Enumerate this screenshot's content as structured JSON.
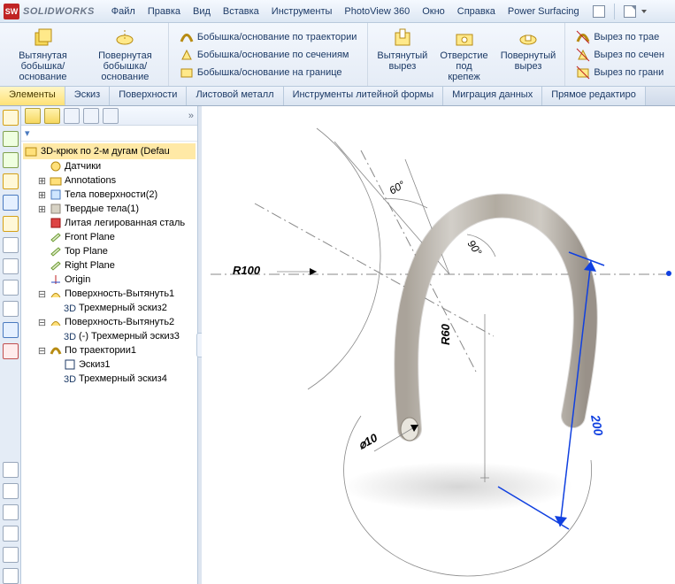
{
  "app": {
    "brand": "SOLIDWORKS",
    "logo_text": "SW"
  },
  "menu": [
    "Файл",
    "Правка",
    "Вид",
    "Вставка",
    "Инструменты",
    "PhotoView 360",
    "Окно",
    "Справка",
    "Power Surfacing"
  ],
  "ribbon": {
    "big": [
      {
        "name": "extrude-boss",
        "label": "Вытянутая\nбобышка/основание"
      },
      {
        "name": "revolve-boss",
        "label": "Повернутая\nбобышка/основание"
      }
    ],
    "stack1": [
      {
        "name": "sweep-boss",
        "label": "Бобышка/основание по траектории"
      },
      {
        "name": "loft-boss",
        "label": "Бобышка/основание по сечениям"
      },
      {
        "name": "boundary-boss",
        "label": "Бобышка/основание на границе"
      }
    ],
    "big2": [
      {
        "name": "extrude-cut",
        "label": "Вытянутый\nвырез"
      },
      {
        "name": "hole-wizard",
        "label": "Отверстие\nпод\nкрепеж"
      },
      {
        "name": "revolve-cut",
        "label": "Повернутый\nвырез"
      }
    ],
    "stack2": [
      {
        "name": "sweep-cut",
        "label": "Вырез по трае"
      },
      {
        "name": "loft-cut",
        "label": "Вырез по сечен"
      },
      {
        "name": "boundary-cut",
        "label": "Вырез по грани"
      }
    ]
  },
  "tabs": [
    "Элементы",
    "Эскиз",
    "Поверхности",
    "Листовой металл",
    "Инструменты литейной формы",
    "Миграция данных",
    "Прямое редактиро"
  ],
  "active_tab": 0,
  "tree": {
    "root": "3D-крюк по 2-м дугам  (Defau",
    "items": [
      {
        "ico": "sensor",
        "label": "Датчики",
        "tw": "",
        "lvl": 1
      },
      {
        "ico": "folder",
        "label": "Annotations",
        "tw": "+",
        "lvl": 1
      },
      {
        "ico": "bodies",
        "label": "Тела поверхности(2)",
        "tw": "+",
        "lvl": 1
      },
      {
        "ico": "solid",
        "label": "Твердые тела(1)",
        "tw": "+",
        "lvl": 1
      },
      {
        "ico": "mat",
        "label": "Литая легированная сталь",
        "tw": "",
        "lvl": 1
      },
      {
        "ico": "plane",
        "label": "Front Plane",
        "tw": "",
        "lvl": 1
      },
      {
        "ico": "plane",
        "label": "Top Plane",
        "tw": "",
        "lvl": 1
      },
      {
        "ico": "plane",
        "label": "Right Plane",
        "tw": "",
        "lvl": 1
      },
      {
        "ico": "origin",
        "label": "Origin",
        "tw": "",
        "lvl": 1
      },
      {
        "ico": "surf",
        "label": "Поверхность-Вытянуть1",
        "tw": "-",
        "lvl": 1
      },
      {
        "ico": "sk3d",
        "label": "Трехмерный эскиз2",
        "tw": "",
        "lvl": 2
      },
      {
        "ico": "surf",
        "label": "Поверхность-Вытянуть2",
        "tw": "-",
        "lvl": 1
      },
      {
        "ico": "sk3d",
        "label": "(-) Трехмерный эскиз3",
        "tw": "",
        "lvl": 2
      },
      {
        "ico": "sweep",
        "label": "По траектории1",
        "tw": "-",
        "lvl": 1
      },
      {
        "ico": "sketch",
        "label": "Эскиз1",
        "tw": "",
        "lvl": 2
      },
      {
        "ico": "sk3d",
        "label": "Трехмерный эскиз4",
        "tw": "",
        "lvl": 2
      }
    ]
  },
  "dims": {
    "r100": "R100",
    "r60": "R60",
    "d10": "⌀10",
    "a60": "60°",
    "a90": "90°",
    "len": "200"
  }
}
